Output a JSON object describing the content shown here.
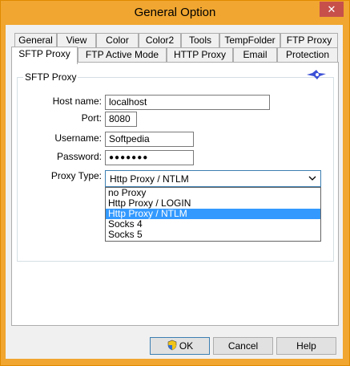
{
  "window": {
    "title": "General Option",
    "close_glyph": "✕"
  },
  "tabs_row1": [
    {
      "label": "General"
    },
    {
      "label": "View"
    },
    {
      "label": "Color"
    },
    {
      "label": "Color2"
    },
    {
      "label": "Tools"
    },
    {
      "label": "TempFolder"
    },
    {
      "label": "FTP Proxy"
    }
  ],
  "tabs_row2": [
    {
      "label": "SFTP Proxy",
      "active": true
    },
    {
      "label": "FTP Active Mode"
    },
    {
      "label": "HTTP Proxy"
    },
    {
      "label": "Email"
    },
    {
      "label": "Protection"
    }
  ],
  "group": {
    "title": "SFTP Proxy"
  },
  "form": {
    "host_label": "Host name:",
    "host_value": "localhost",
    "port_label": "Port:",
    "port_value": "8080",
    "user_label": "Username:",
    "user_value": "Softpedia",
    "pass_label": "Password:",
    "pass_value": "●●●●●●●",
    "type_label": "Proxy Type:",
    "type_value": "Http Proxy / NTLM"
  },
  "dropdown_options": [
    "no Proxy",
    "Http Proxy / LOGIN",
    "Http Proxy / NTLM",
    "Socks 4",
    "Socks 5"
  ],
  "dropdown_selected_index": 2,
  "buttons": {
    "ok": "OK",
    "cancel": "Cancel",
    "help": "Help"
  },
  "icons": {
    "logo": "star-logo-icon",
    "shield": "uac-shield-icon",
    "chevron": "chevron-down-icon"
  },
  "colors": {
    "titlebar": "#f0a630",
    "close": "#c7504b",
    "selection": "#3399ff",
    "logo": "#3b4fd6"
  }
}
